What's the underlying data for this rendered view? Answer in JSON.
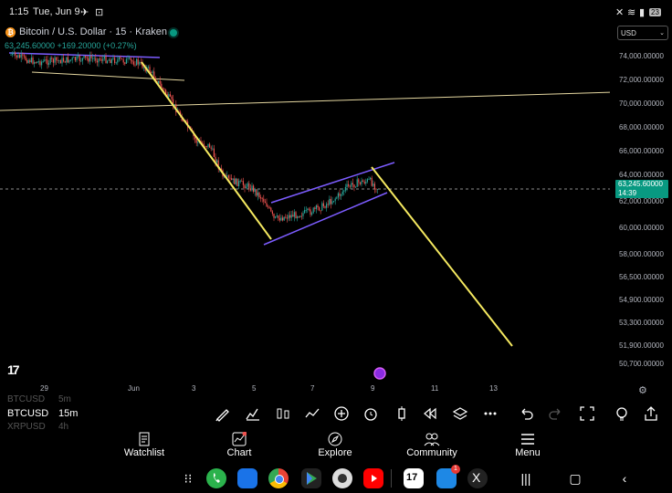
{
  "status_bar": {
    "time": "1:15",
    "date": "Tue, Jun 9",
    "battery": "23"
  },
  "symbol": {
    "title": "Bitcoin / U.S. Dollar · 15 · Kraken",
    "btc_glyph": "₿",
    "price_line": "63,245.60000 +169.20000 (+0.27%)",
    "currency": "USD"
  },
  "chart_data": {
    "type": "candlestick",
    "y_ticks": [
      "74,000.00000",
      "72,000.00000",
      "70,000.00000",
      "68,000.00000",
      "66,000.00000",
      "64,000.00000",
      "62,000.00000",
      "60,000.00000",
      "58,000.00000",
      "56,500.00000",
      "54,900.00000",
      "53,300.00000",
      "51,900.00000",
      "50,700.00000"
    ],
    "x_ticks": [
      "29",
      "Jun",
      "3",
      "5",
      "7",
      "9",
      "11",
      "13"
    ],
    "last_price": "63,245.60000",
    "countdown": "14:39",
    "colors": {
      "up": "#26a69a",
      "down": "#ef5350",
      "trend": "#f5e960",
      "channel": "#7c5cff",
      "horizontal": "#e5d7a0",
      "price_line": "#bbbbbb"
    }
  },
  "watchlist": [
    {
      "symbol": "BTCUSD",
      "interval": "5m",
      "dim": true
    },
    {
      "symbol": "BTCUSD",
      "interval": "15m",
      "dim": false
    },
    {
      "symbol": "XRPUSD",
      "interval": "4h",
      "dim": true
    }
  ],
  "nav": {
    "watchlist": "Watchlist",
    "chart": "Chart",
    "explore": "Explore",
    "community": "Community",
    "menu": "Menu"
  },
  "tv_logo": "17",
  "apps_badge": "1"
}
